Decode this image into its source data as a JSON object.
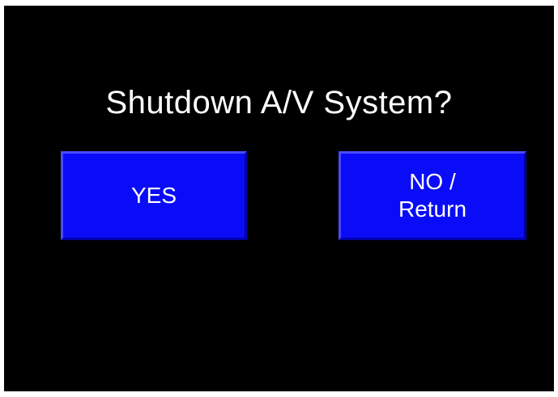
{
  "dialog": {
    "title": "Shutdown A/V System?",
    "yes_label": "YES",
    "no_label": "NO /\nReturn"
  },
  "colors": {
    "background": "#000000",
    "button": "#0a0cf7",
    "text": "#ffffff"
  }
}
